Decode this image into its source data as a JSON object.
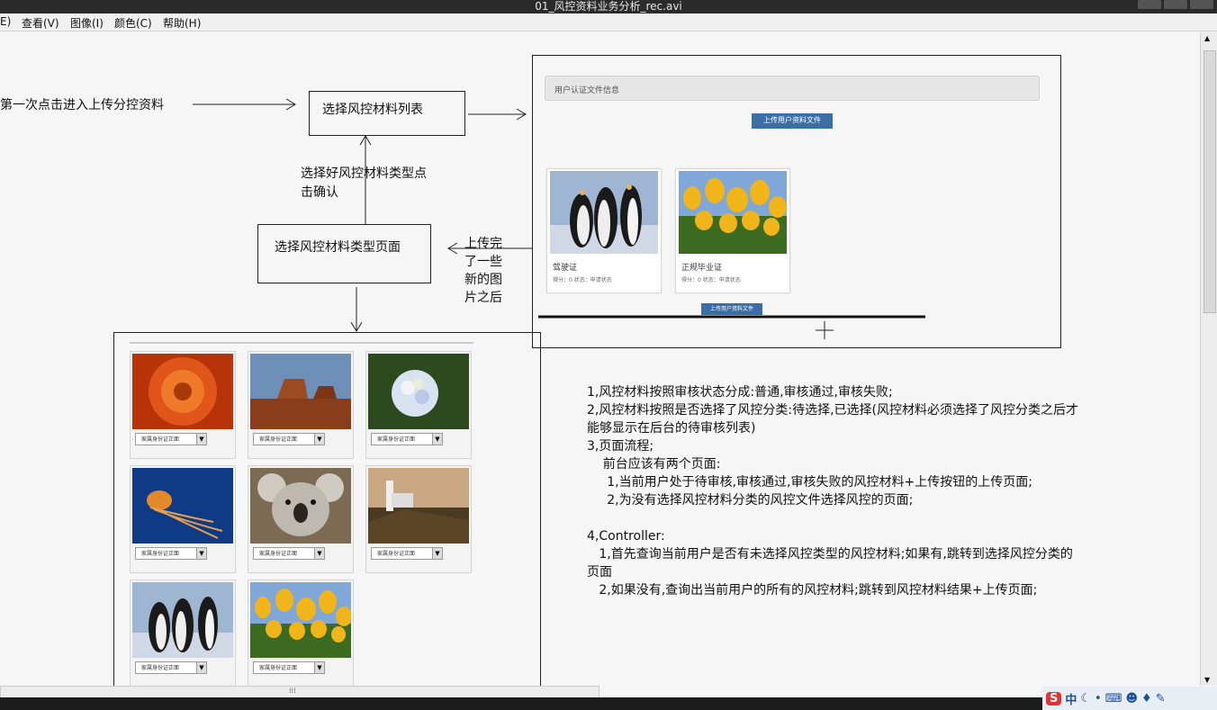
{
  "window": {
    "title": "01_风控资料业务分析_rec.avi"
  },
  "menu": [
    "E)",
    "查看(V)",
    "图像(I)",
    "颜色(C)",
    "帮助(H)"
  ],
  "flow": {
    "entry_text": "第一次点击进入上传分控资料",
    "box1": "选择风控材料列表",
    "confirm_text_1": "选择好风控材料类型点",
    "confirm_text_2": "击确认",
    "box2": "选择风控材料类型页面",
    "upload_done": [
      "上传完",
      "了一些",
      "新的图",
      "片之后"
    ]
  },
  "right_panel": {
    "header": "用户认证文件信息",
    "upload_button": "上传用户资料文件",
    "cards": [
      {
        "title": "驾驶证",
        "meta": "得分：0    状态：申请状态",
        "image": "penguins"
      },
      {
        "title": "正规毕业证",
        "meta": "得分：0    状态：申请状态",
        "image": "tulips"
      }
    ],
    "bottom_button": "上传用户资料文件"
  },
  "gallery": {
    "select_placeholder": "家属身份证正面",
    "images": [
      "chrysanthemum",
      "desert",
      "hydrangea",
      "jellyfish",
      "koala",
      "lighthouse",
      "penguins",
      "tulips"
    ]
  },
  "notes": [
    "1,风控材料按照审核状态分成:普通,审核通过,审核失败;",
    "2,风控材料按照是否选择了风控分类:待选择,已选择(风控材料必须选择了风控分类之后才",
    "能够显示在后台的待审核列表)",
    "3,页面流程;",
    "    前台应该有两个页面:",
    "     1,当前用户处于待审核,审核通过,审核失败的风控材料+上传按钮的上传页面;",
    "     2,为没有选择风控材料分类的风控文件选择风控的页面;",
    "",
    "4,Controller:",
    "   1,首先查询当前用户是否有未选择风控类型的风控材料;如果有,跳转到选择风控分类的",
    "页面",
    "   2,如果没有,查询出当前用户的所有的风控材料;跳转到风控材料结果+上传页面;"
  ],
  "tray": {
    "ime": "中",
    "icons": [
      "sogou-icon",
      "moon-icon",
      "dot-icon",
      "keyboard-icon",
      "user-icon",
      "shirt-icon",
      "wrench-icon"
    ]
  }
}
